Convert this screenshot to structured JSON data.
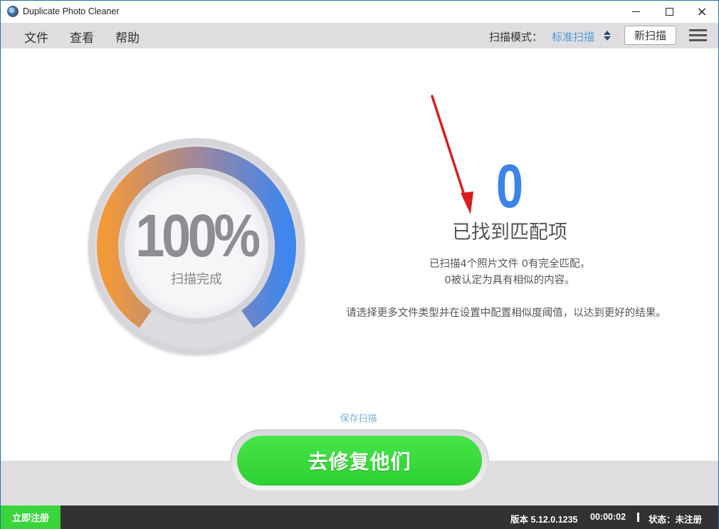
{
  "window": {
    "title": "Duplicate Photo Cleaner",
    "app_icon": "app-logo-icon",
    "controls": {
      "minimize": "minimize-icon",
      "maximize": "maximize-icon",
      "close": "×"
    }
  },
  "menubar": {
    "items": [
      {
        "label": "文件"
      },
      {
        "label": "查看"
      },
      {
        "label": "帮助"
      }
    ],
    "scan_mode_label": "扫描模式：",
    "scan_mode_value": "标准扫描",
    "new_scan_label": "新扫描",
    "menu_icon": "hamburger-menu-icon"
  },
  "gauge": {
    "percent_text": "100%",
    "progress": 1.0,
    "subtitle": "扫描完成",
    "colors": {
      "start": "#f2993a",
      "mid": "#a0879a",
      "end": "#3f86ee",
      "track": "#d6d5d9"
    }
  },
  "results": {
    "match_count": "0",
    "match_title": "已找到匹配项",
    "summary_line1": "已扫描4个照片文件 0有完全匹配，",
    "summary_line2": "0被认定为具有相似的内容。",
    "hint": "请选择更多文件类型并在设置中配置相似度阈值，以达到更好的结果。",
    "accent_color": "#3d83e8"
  },
  "annotation": {
    "arrow_color": "#d41f1f"
  },
  "actions": {
    "save_scan_label": "保存扫描",
    "fix_button_label": "去修复他们",
    "fix_button_color": "#3ad43c"
  },
  "statusbar": {
    "register_label": "立即注册",
    "version": "版本 5.12.0.1235",
    "elapsed": "00:00:02",
    "status": "状态：未注册"
  }
}
